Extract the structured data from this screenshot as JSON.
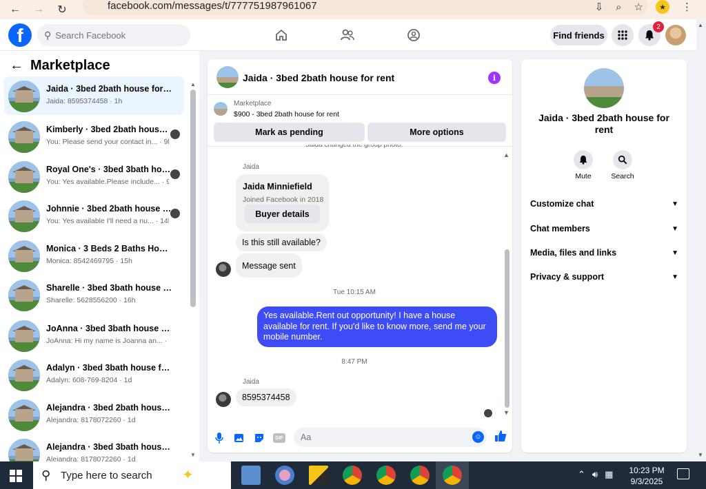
{
  "browser": {
    "url": "facebook.com/messages/t/777751987961067"
  },
  "fb_header": {
    "search_placeholder": "Search Facebook",
    "find_friends": "Find friends",
    "notification_count": "2"
  },
  "sidebar": {
    "title": "Marketplace",
    "conversations": [
      {
        "title": "Jaida · 3bed 2bath house for rent",
        "snippet": "Jaida: 8595374458 · 1h"
      },
      {
        "title": "Kimberly · 3bed 2bath house ...",
        "snippet": "You: Please send your contact in... · 9h"
      },
      {
        "title": "Royal One's · 3bed 3bath hou...",
        "snippet": "You: Yes available.Please include... · 9h"
      },
      {
        "title": "Johnnie · 3bed 2bath house f...",
        "snippet": "You: Yes available I'll need a nu... · 14h"
      },
      {
        "title": "Monica · 3 Beds 2 Baths House",
        "snippet": "Monica: 8542469795 · 15h"
      },
      {
        "title": "Sharelle · 3bed 3bath house for ...",
        "snippet": "Sharelle: 5628556200 · 16h"
      },
      {
        "title": "JoAnna · 3bed 3bath house for ...",
        "snippet": "JoAnna: Hi my name is Joanna an... · 16h"
      },
      {
        "title": "Adalyn · 3bed 3bath house for r...",
        "snippet": "Adalyn: 608-769-8204 · 1d"
      },
      {
        "title": "Alejandra · 3bed 2bath house f...",
        "snippet": "Alejandra: 8178072260 · 1d"
      },
      {
        "title": "Alejandra · 3bed 3bath house f...",
        "snippet": "Alejandra: 8178072260 · 1d"
      }
    ]
  },
  "chat": {
    "title": "Jaida · 3bed 2bath house for rent",
    "marketplace_label": "Marketplace",
    "listing": "$900 - 3bed 2bath house for rent",
    "mark_pending": "Mark as pending",
    "more_options": "More options",
    "system_message": "Jaida changed the group photo.",
    "sender_1": "Jaida",
    "card_name": "Jaida Minniefield",
    "card_joined": "Joined Facebook in 2018",
    "card_button": "Buyer details",
    "msg_still_available": "Is this still available?",
    "msg_sent": "Message sent",
    "time_1": "Tue 10:15 AM",
    "outgoing": "Yes available.Rent out opportunity! I have a house available for rent. If you'd like to know more, send me your mobile number.",
    "time_2": "8:47 PM",
    "sender_2": "Jaida",
    "msg_phone": "8595374458",
    "composer_placeholder": "Aa"
  },
  "right_panel": {
    "title": "Jaida · 3bed 2bath house for rent",
    "mute": "Mute",
    "search": "Search",
    "sections": [
      "Customize chat",
      "Chat members",
      "Media, files and links",
      "Privacy & support"
    ]
  },
  "taskbar": {
    "search_placeholder": "Type here to search",
    "time": "10:23 PM",
    "date": "9/3/2025"
  },
  "colors": {
    "fb_blue": "#0866ff",
    "outgoing_bubble": "#3d4cf5",
    "info_purple": "#a033ff"
  }
}
